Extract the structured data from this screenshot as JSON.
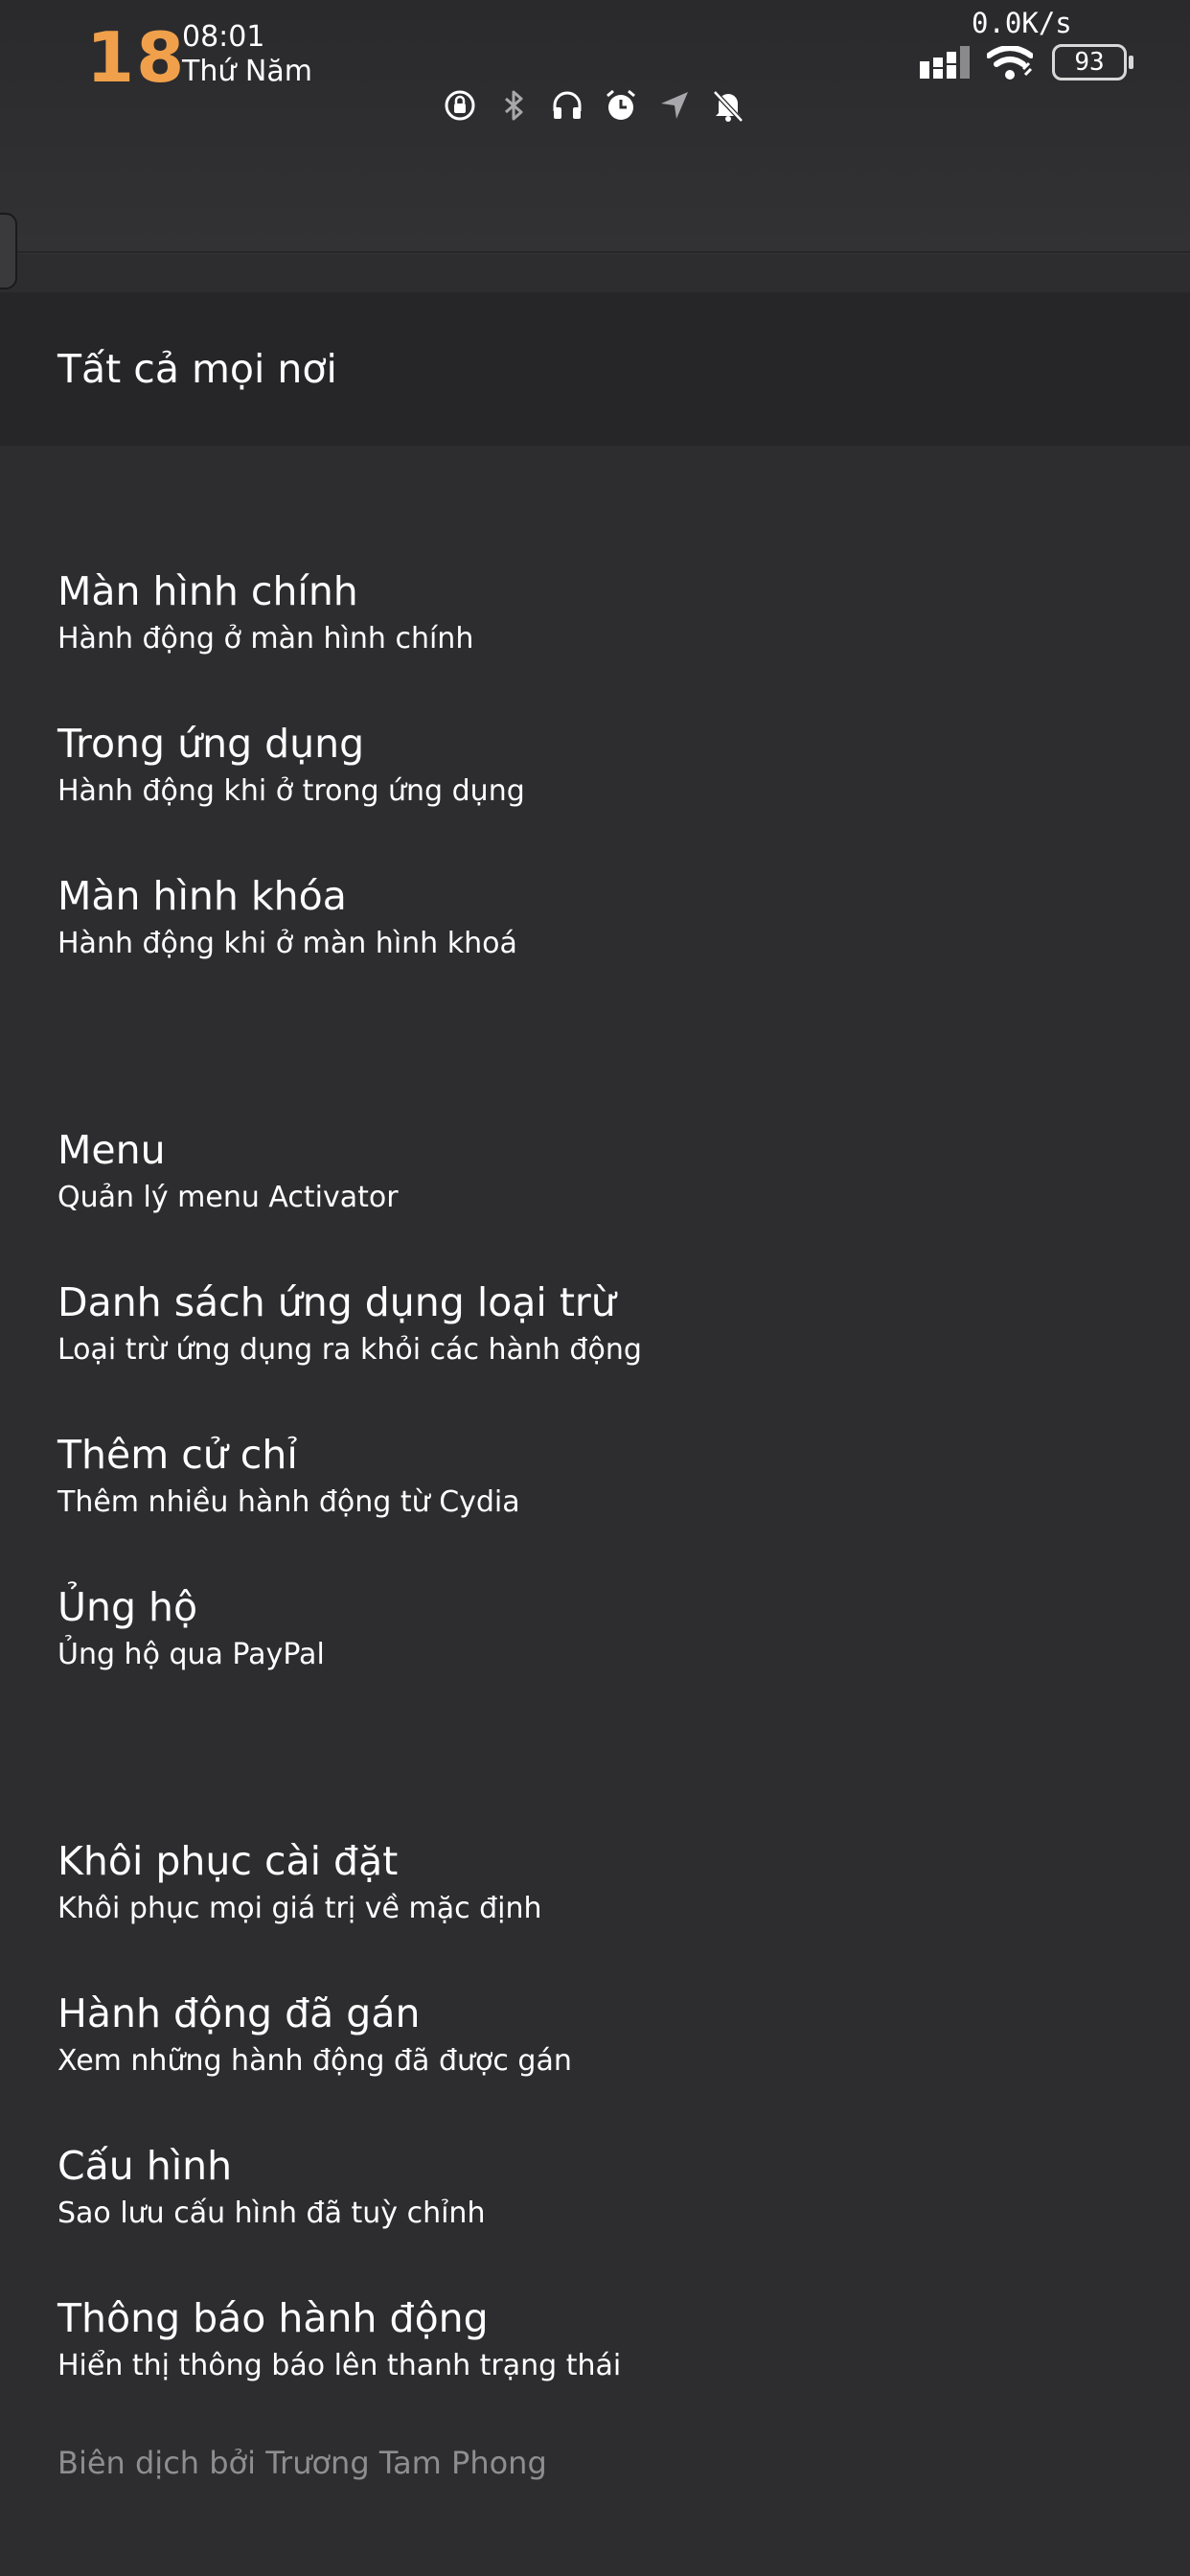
{
  "status_bar": {
    "day_number": "18",
    "time": "08:01",
    "weekday": "Thứ Năm",
    "net_speed": "0.0K/s",
    "battery": "93",
    "icons": [
      "rotation-lock-icon",
      "bluetooth-icon",
      "headphones-icon",
      "alarm-icon",
      "location-icon",
      "bell-off-icon"
    ],
    "accent_color": "#f0a04a"
  },
  "all_everywhere": {
    "label": "Tất cả mọi nơi"
  },
  "sections": {
    "modes": [
      {
        "title": "Màn hình chính",
        "subtitle": "Hành động ở màn hình chính"
      },
      {
        "title": "Trong ứng dụng",
        "subtitle": "Hành động khi ở trong ứng dụng"
      },
      {
        "title": "Màn hình khóa",
        "subtitle": "Hành động khi ở màn hình khoá"
      }
    ],
    "management": [
      {
        "title": "Menu",
        "subtitle": "Quản lý menu Activator"
      },
      {
        "title": "Danh sách ứng dụng loại trừ",
        "subtitle": "Loại trừ ứng dụng ra khỏi các hành động"
      },
      {
        "title": "Thêm cử chỉ",
        "subtitle": "Thêm nhiều hành động từ Cydia"
      },
      {
        "title": "Ủng hộ",
        "subtitle": "Ủng hộ qua PayPal"
      }
    ],
    "settings": [
      {
        "title": "Khôi phục cài đặt",
        "subtitle": "Khôi phục mọi giá trị về mặc định"
      },
      {
        "title": "Hành động đã gán",
        "subtitle": "Xem những hành động đã được gán"
      },
      {
        "title": "Cấu hình",
        "subtitle": "Sao lưu cấu hình đã tuỳ chỉnh"
      },
      {
        "title": "Thông báo hành động",
        "subtitle": "Hiển thị thông báo lên thanh trạng thái"
      }
    ]
  },
  "credit": "Biên dịch bởi Trương Tam Phong"
}
